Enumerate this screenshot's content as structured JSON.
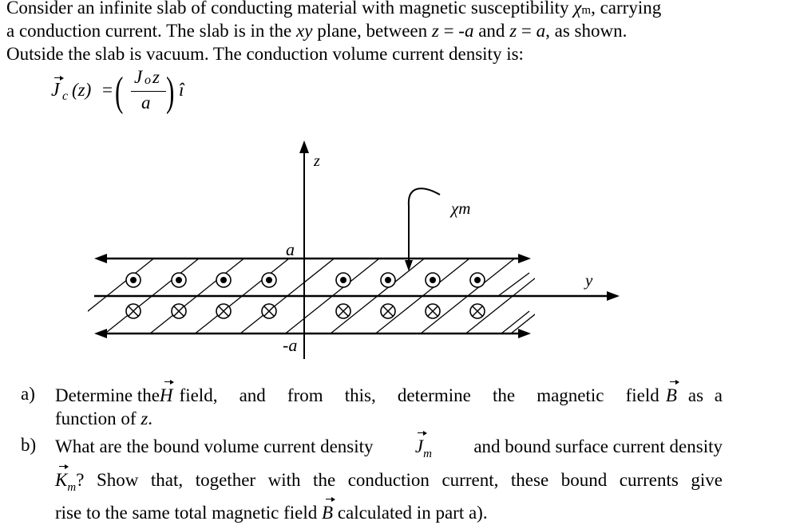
{
  "intro": {
    "line1_a": "Consider an infinite slab of conducting material with magnetic susceptibility ",
    "chi": "χ",
    "chi_sub": "m",
    "line1_b": ", carrying",
    "line2_a": "a conduction current. The slab is in the ",
    "line2_xy": "xy",
    "line2_b": " plane, between ",
    "z1": "z",
    "eq1": " = -",
    "a1": "a",
    "and": " and ",
    "z2": "z",
    "eq2": " = ",
    "a2": "a",
    "line2_c": ", as shown.",
    "line3": "Outside the slab is vacuum. The conduction volume current density is:"
  },
  "formula": {
    "lhs_symbol": "J",
    "lhs_sub": "c",
    "lhs_arg": "(z)",
    "equals": "=",
    "numerator": "J",
    "numerator_sub": "o",
    "numerator_var": "z",
    "denominator": "a",
    "unit_vector": "î"
  },
  "diagram": {
    "z_axis_label": "z",
    "y_axis_label": "y",
    "top_label": "a",
    "bottom_label": "-a",
    "material_label": "χm",
    "upper_half_symbol": "out-of-page (dot)",
    "lower_half_symbol": "into-page (cross)",
    "dot_count": 8,
    "cross_count": 8
  },
  "questions": [
    {
      "label": "a)",
      "line1": [
        "Determine the",
        "H",
        "field, and from this, determine the magnetic field",
        "B",
        "as a"
      ],
      "line2_a": "function of ",
      "line2_z": "z",
      "line2_b": "."
    },
    {
      "label": "b)",
      "line1_a": "What are the bound volume current density ",
      "Jm": "J",
      "Jm_sub": "m",
      "line1_b": " and bound surface current density",
      "Km": "K",
      "Km_sub": "m",
      "line2": "? Show that, together with the conduction current, these bound currents give",
      "line3_a": "rise to the same total magnetic field ",
      "B": "B",
      "line3_b": " calculated in part a)."
    }
  ]
}
